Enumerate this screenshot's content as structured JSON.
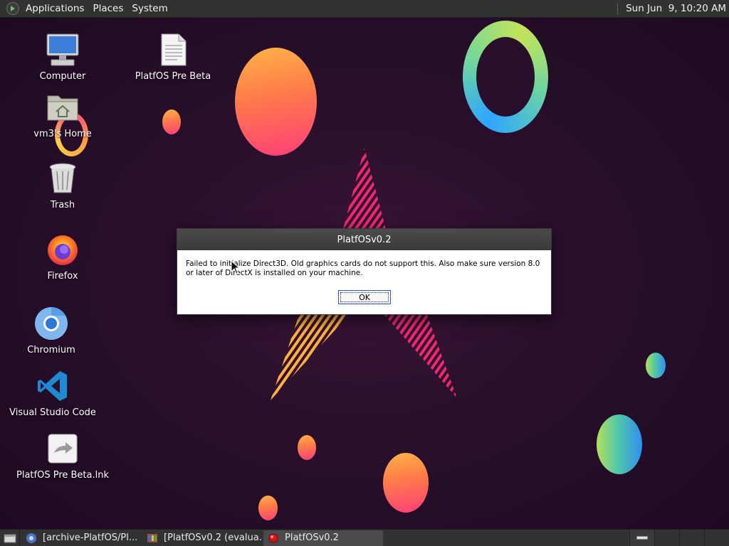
{
  "top_panel": {
    "menu": [
      "Applications",
      "Places",
      "System"
    ],
    "clock": "Sun Jun  9, 10:20 AM"
  },
  "desktop_icons": [
    {
      "label": "Computer",
      "icon": "computer-icon"
    },
    {
      "label": "PlatfOS Pre Beta",
      "icon": "document-icon"
    },
    {
      "label": "vm3's Home",
      "icon": "home-folder-icon"
    },
    {
      "label": "Trash",
      "icon": "trash-icon"
    },
    {
      "label": "Firefox",
      "icon": "firefox-icon"
    },
    {
      "label": "Chromium",
      "icon": "chromium-icon"
    },
    {
      "label": "Visual Studio Code",
      "icon": "vscode-icon"
    },
    {
      "label": "PlatfOS Pre Beta.lnk",
      "icon": "shortcut-icon"
    }
  ],
  "dialog": {
    "title": "PlatfOSv0.2",
    "message": "Failed to initialize Direct3D. Old graphics cards do not support this. Also make sure version 8.0 or later of DirectX is installed on your machine.",
    "ok_label": "OK"
  },
  "taskbar": {
    "tasks": [
      {
        "label": "[archive-PlatfOS/Pl...",
        "icon": "browser-icon",
        "active": false
      },
      {
        "label": "[PlatfOSv0.2 (evalua...",
        "icon": "archive-icon",
        "active": false
      },
      {
        "label": "PlatfOSv0.2",
        "icon": "red-dot-icon",
        "active": true
      }
    ]
  }
}
